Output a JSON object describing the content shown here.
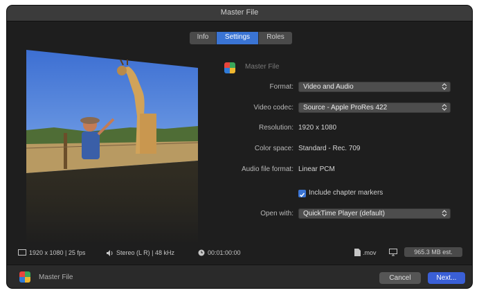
{
  "window": {
    "title": "Master File"
  },
  "tabs": [
    {
      "label": "Info",
      "active": false
    },
    {
      "label": "Settings",
      "active": true
    },
    {
      "label": "Roles",
      "active": false
    }
  ],
  "preset": {
    "name": "Master File",
    "icon": "final-cut-pro-icon"
  },
  "settings": {
    "format": {
      "label": "Format:",
      "value": "Video and Audio"
    },
    "video_codec": {
      "label": "Video codec:",
      "value": "Source - Apple ProRes 422"
    },
    "resolution": {
      "label": "Resolution:",
      "value": "1920 x 1080"
    },
    "color_space": {
      "label": "Color space:",
      "value": "Standard - Rec. 709"
    },
    "audio_format": {
      "label": "Audio file format:",
      "value": "Linear PCM"
    },
    "chapter_markers": {
      "label": "Include chapter markers",
      "checked": true
    },
    "open_with": {
      "label": "Open with:",
      "value": "QuickTime Player (default)"
    }
  },
  "status": {
    "video": "1920 x 1080 | 25 fps",
    "audio": "Stereo (L R) | 48 kHz",
    "duration": "00:01:00:00",
    "file_ext": ".mov",
    "size": "965.3 MB est."
  },
  "footer": {
    "preset_name": "Master File",
    "cancel_label": "Cancel",
    "next_label": "Next..."
  },
  "colors": {
    "accent": "#3a74d4",
    "next_button": "#3a5fd6",
    "window_bg": "#1e1e1e"
  }
}
